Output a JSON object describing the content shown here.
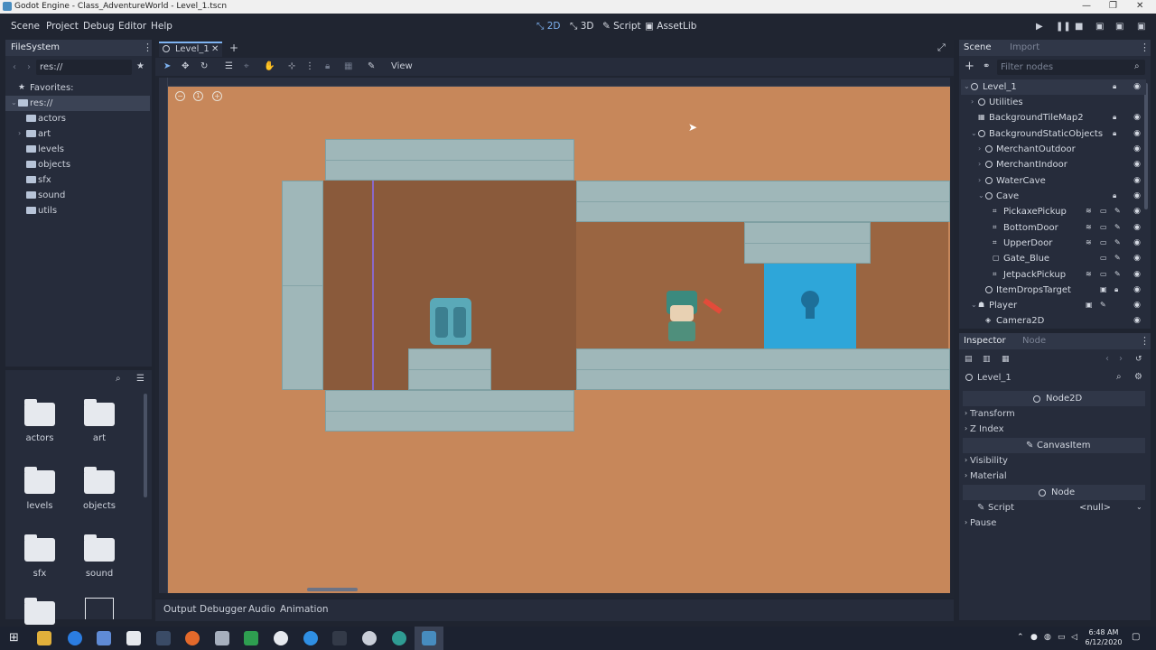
{
  "window": {
    "title": "Godot Engine - Class_AdventureWorld - Level_1.tscn",
    "controls": [
      "—",
      "❐",
      "✕"
    ]
  },
  "menu": [
    "Scene",
    "Project",
    "Debug",
    "Editor",
    "Help"
  ],
  "modes": [
    {
      "label": "2D",
      "icon": "2d-icon"
    },
    {
      "label": "3D",
      "icon": "3d-icon"
    },
    {
      "label": "Script",
      "icon": "script-icon"
    },
    {
      "label": "AssetLib",
      "icon": "assetlib-icon"
    }
  ],
  "filesystem": {
    "tab": "FileSystem",
    "path": "res://",
    "favorites": "Favorites:",
    "root": "res://",
    "folders": [
      "actors",
      "art",
      "levels",
      "objects",
      "sfx",
      "sound",
      "utils"
    ],
    "grid": [
      "actors",
      "art",
      "levels",
      "objects",
      "sfx",
      "sound"
    ]
  },
  "editor": {
    "scene_tab": "Level_1",
    "view_menu": "View",
    "zoom": [
      "−",
      "1",
      "+"
    ]
  },
  "scene": {
    "tabs": [
      "Scene",
      "Import"
    ],
    "filter_placeholder": "Filter nodes",
    "nodes": [
      "Level_1",
      "Utilities",
      "BackgroundTileMap2",
      "BackgroundStaticObjects",
      "MerchantOutdoor",
      "MerchantIndoor",
      "WaterCave",
      "Cave",
      "PickaxePickup",
      "BottomDoor",
      "UpperDoor",
      "Gate_Blue",
      "JetpackPickup",
      "ItemDropsTarget",
      "Player",
      "Camera2D"
    ]
  },
  "inspector": {
    "tabs": [
      "Inspector",
      "Node"
    ],
    "object": "Level_1",
    "node2d": "Node2D",
    "transform": "Transform",
    "zindex": "Z Index",
    "canvasitem": "CanvasItem",
    "visibility": "Visibility",
    "material": "Material",
    "node": "Node",
    "script_label": "Script",
    "script_value": "<null>",
    "pause": "Pause"
  },
  "bottom_tabs": [
    "Output",
    "Debugger",
    "Audio",
    "Animation"
  ],
  "taskbar": {
    "time": "6:48 AM",
    "date": "6/12/2020"
  },
  "colors": {
    "accent": "#7eb3f2",
    "bg": "#262c3b",
    "viewport": "#c7875a"
  }
}
